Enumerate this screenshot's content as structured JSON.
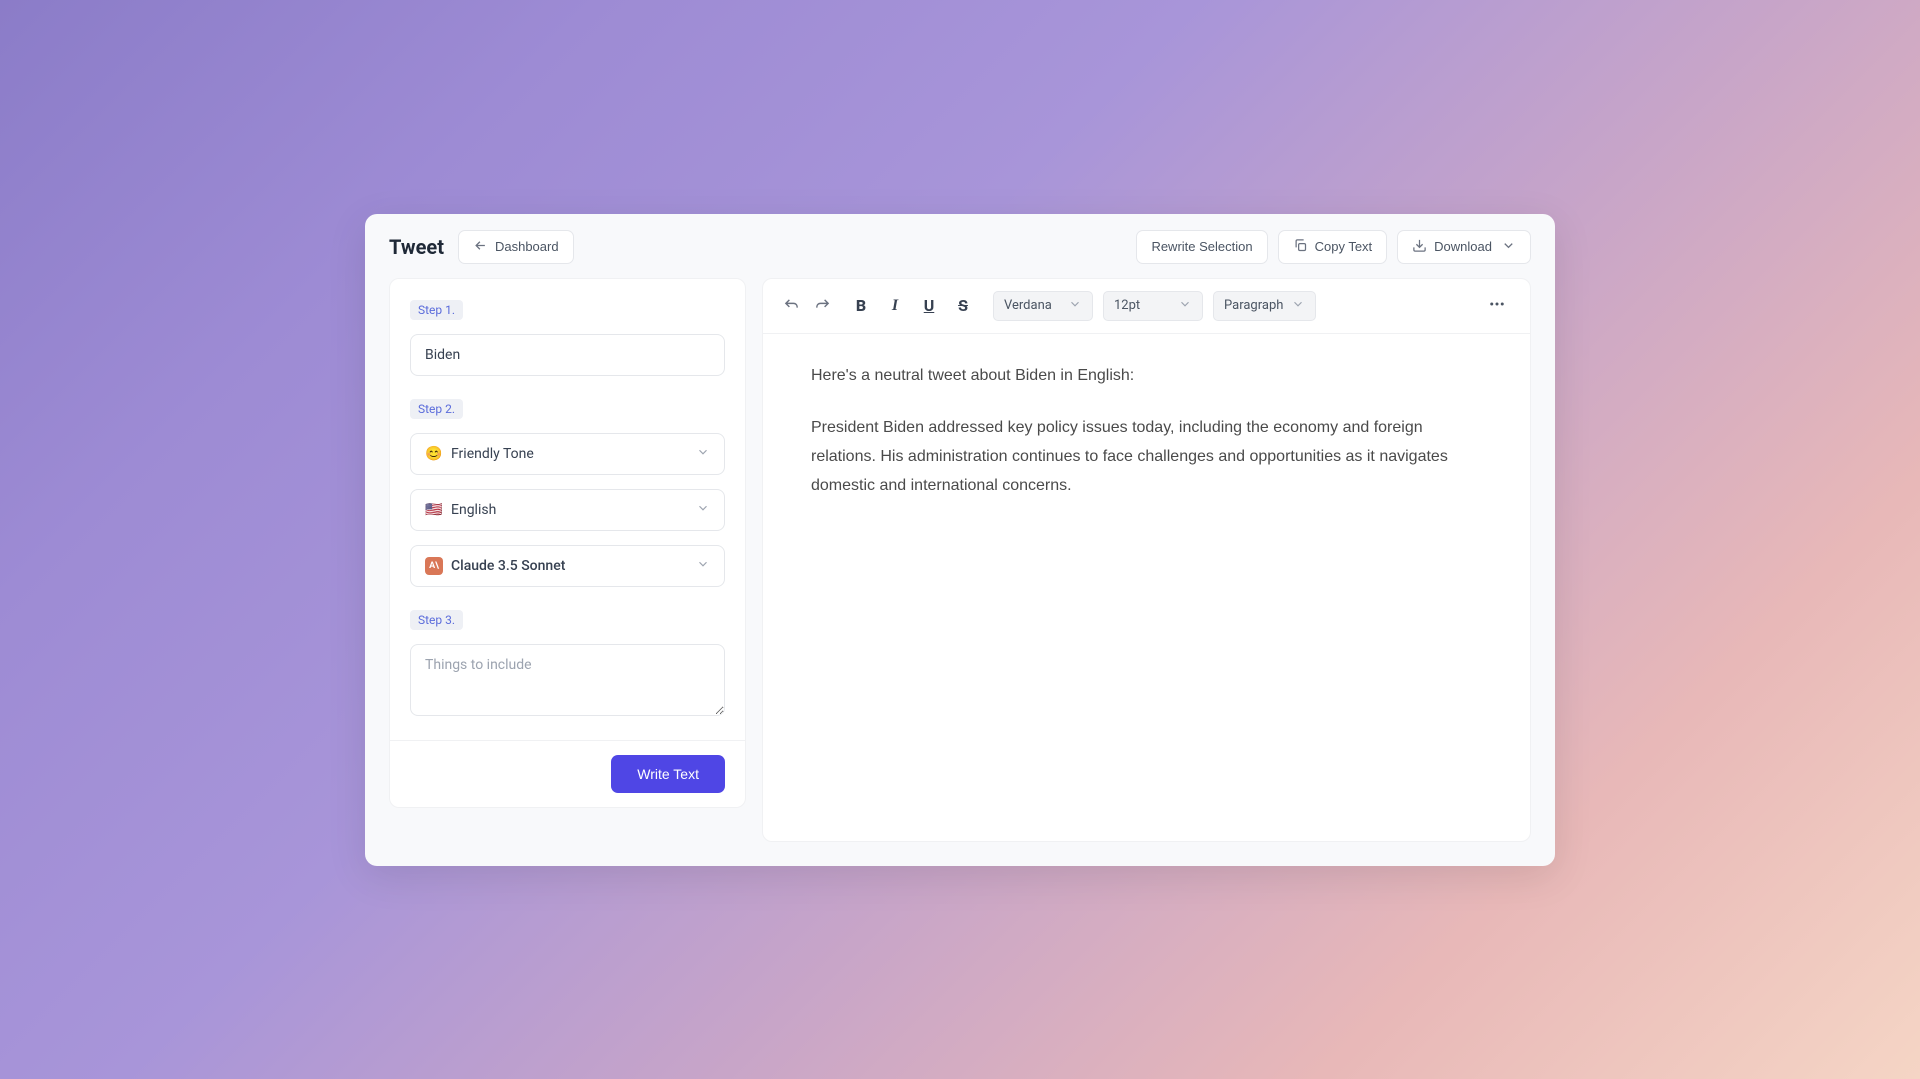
{
  "header": {
    "title": "Tweet",
    "dashboard_label": "Dashboard",
    "rewrite_label": "Rewrite Selection",
    "copy_label": "Copy Text",
    "download_label": "Download"
  },
  "sidebar": {
    "step1_label": "Step 1.",
    "topic_value": "Biden",
    "step2_label": "Step 2.",
    "tone": {
      "icon": "😊",
      "label": "Friendly Tone"
    },
    "language": {
      "icon": "🇺🇸",
      "label": "English"
    },
    "model": {
      "icon": "A\\",
      "label": "Claude 3.5 Sonnet"
    },
    "step3_label": "Step 3.",
    "include_placeholder": "Things to include",
    "write_button": "Write Text"
  },
  "toolbar": {
    "font": "Verdana",
    "size": "12pt",
    "block": "Paragraph"
  },
  "editor": {
    "intro": "Here's a neutral tweet about Biden in English:",
    "body": "President Biden addressed key policy issues today, including the economy and foreign relations. His administration continues to face challenges and opportunities as it navigates domestic and international concerns."
  }
}
